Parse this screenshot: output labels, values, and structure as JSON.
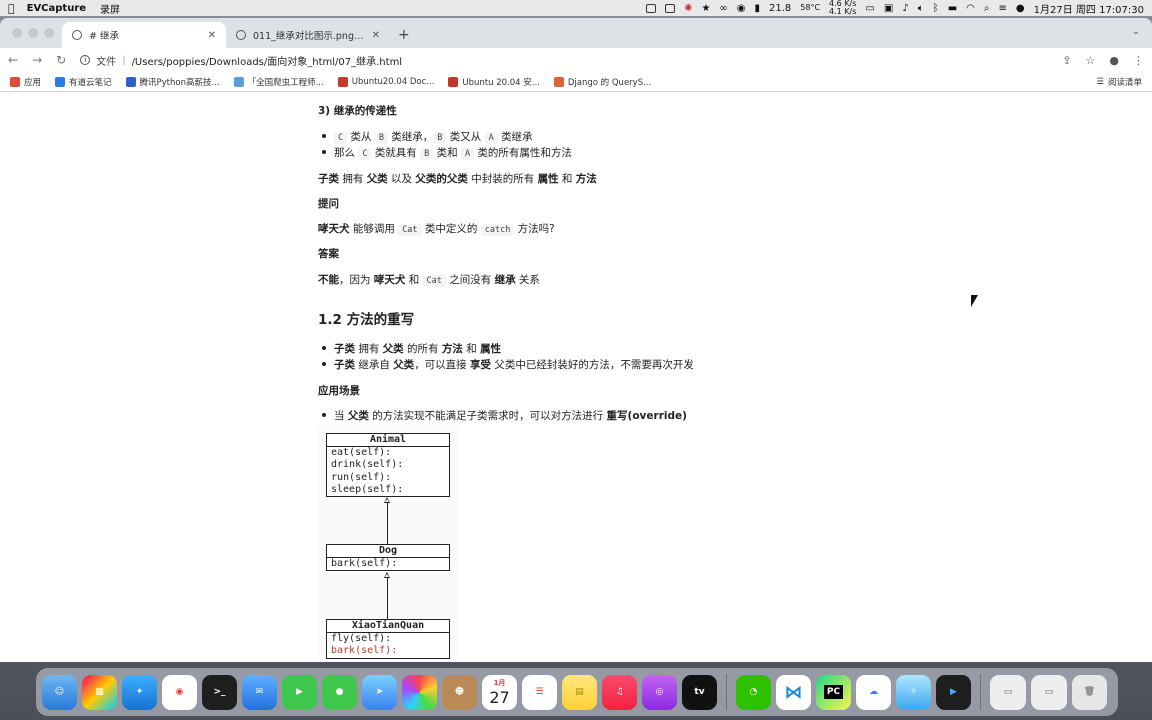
{
  "menubar": {
    "app_name": "EVCapture",
    "menu_item": "录屏",
    "temperature": "58°C",
    "battery_text": "21.8",
    "net_up": "4.6 K/s",
    "net_down": "4.1 K/s",
    "datetime": "1月27日 周四 17:07:30"
  },
  "tabs": [
    {
      "title": "# 继承",
      "active": true
    },
    {
      "title": "011_继承对比图示.png (2065×",
      "active": false
    }
  ],
  "toolbar": {
    "scheme_label": "文件",
    "url": "/Users/poppies/Downloads/面向对象_html/07_继承.html"
  },
  "bookmarks": [
    {
      "label": "应用",
      "color": "#e14b3b"
    },
    {
      "label": "有道云笔记",
      "color": "#2f7be5"
    },
    {
      "label": "腾讯Python高薪技...",
      "color": "#2f5fd0"
    },
    {
      "label": "「全国爬虫工程师...",
      "color": "#5aa0d8"
    },
    {
      "label": "Ubuntu20.04 Doc...",
      "color": "#c0392b"
    },
    {
      "label": "Ubuntu 20.04 安...",
      "color": "#c0392b"
    },
    {
      "label": "Django 的 QueryS...",
      "color": "#e0603a"
    }
  ],
  "reading_list": "阅读清单",
  "article": {
    "s3_heading": "3) 继承的传递性",
    "s3_li1": {
      "c": "C",
      "t1": "类从",
      "b": "B",
      "t2": "类继承，",
      "b2": "B",
      "t3": "类又从",
      "a": "A",
      "t4": "类继承"
    },
    "s3_li2": {
      "t1": "那么",
      "c": "C",
      "t2": "类就具有",
      "b": "B",
      "t3": "类和",
      "a": "A",
      "t4": "类的所有属性和方法"
    },
    "summary": {
      "b1": "子类",
      "t1": "拥有",
      "b2": "父类",
      "t2": "以及",
      "b3": "父类的父类",
      "t3": "中封装的所有",
      "b4": "属性",
      "t4": "和",
      "b5": "方法"
    },
    "question_label": "提问",
    "question": {
      "b1": "哮天犬",
      "t1": "能够调用",
      "c1": "Cat",
      "t2": "类中定义的",
      "c2": "catch",
      "t3": "方法吗?"
    },
    "answer_label": "答案",
    "answer": {
      "b1": "不能",
      "t1": "，因为",
      "b2": "哮天犬",
      "t2": "和",
      "c1": "Cat",
      "t3": "之间没有",
      "b3": "继承",
      "t4": "关系"
    },
    "h2": "1.2 方法的重写",
    "o_li1": {
      "b1": "子类",
      "t1": "拥有",
      "b2": "父类",
      "t2": "的所有",
      "b3": "方法",
      "t3": "和",
      "b4": "属性"
    },
    "o_li2": {
      "b1": "子类",
      "t1": "继承自",
      "b2": "父类",
      "t2": "，可以直接",
      "b3": "享受",
      "t3": "父类中已经封装好的方法，不需要再次开发"
    },
    "scenario_label": "应用场景",
    "s_li1": {
      "t1": "当",
      "b1": "父类",
      "t2": "的方法实现不能满足子类需求时，可以对方法进行",
      "b2": "重写(override)"
    }
  },
  "uml": {
    "animal": {
      "name": "Animal",
      "methods": [
        "eat(self):",
        "drink(self):",
        "run(self):",
        "sleep(self):"
      ]
    },
    "dog": {
      "name": "Dog",
      "methods": [
        "bark(self):"
      ]
    },
    "xtq": {
      "name": "XiaoTianQuan",
      "methods": [
        "fly(self):",
        "bark(self):"
      ]
    }
  },
  "dock": {
    "calendar_month": "1月",
    "calendar_day": "27",
    "tv_label": "tv",
    "pycharm_label": "PC"
  }
}
